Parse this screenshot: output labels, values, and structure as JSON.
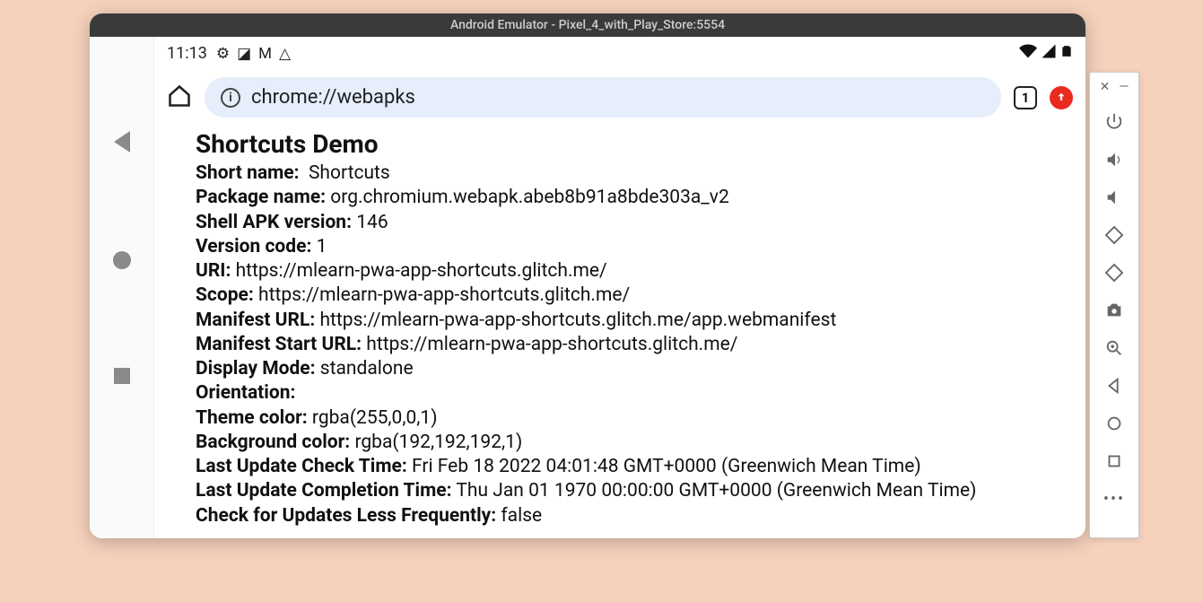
{
  "window": {
    "title": "Android Emulator - Pixel_4_with_Play_Store:5554"
  },
  "statusbar": {
    "time": "11:13"
  },
  "urlbar": {
    "url": "chrome://webapks",
    "tab_count": "1"
  },
  "page": {
    "title": "Shortcuts Demo",
    "fields": {
      "short_name": {
        "label": "Short name:",
        "value": "Shortcuts"
      },
      "package_name": {
        "label": "Package name:",
        "value": "org.chromium.webapk.abeb8b91a8bde303a_v2"
      },
      "shell_apk_version": {
        "label": "Shell APK version:",
        "value": "146"
      },
      "version_code": {
        "label": "Version code:",
        "value": "1"
      },
      "uri": {
        "label": "URI:",
        "value": "https://mlearn-pwa-app-shortcuts.glitch.me/"
      },
      "scope": {
        "label": "Scope:",
        "value": "https://mlearn-pwa-app-shortcuts.glitch.me/"
      },
      "manifest_url": {
        "label": "Manifest URL:",
        "value": "https://mlearn-pwa-app-shortcuts.glitch.me/app.webmanifest"
      },
      "manifest_start_url": {
        "label": "Manifest Start URL:",
        "value": "https://mlearn-pwa-app-shortcuts.glitch.me/"
      },
      "display_mode": {
        "label": "Display Mode:",
        "value": "standalone"
      },
      "orientation": {
        "label": "Orientation:",
        "value": ""
      },
      "theme_color": {
        "label": "Theme color:",
        "value": "rgba(255,0,0,1)"
      },
      "background_color": {
        "label": "Background color:",
        "value": "rgba(192,192,192,1)"
      },
      "last_update_check": {
        "label": "Last Update Check Time:",
        "value": "Fri Feb 18 2022 04:01:48 GMT+0000 (Greenwich Mean Time)"
      },
      "last_update_completion": {
        "label": "Last Update Completion Time:",
        "value": "Thu Jan 01 1970 00:00:00 GMT+0000 (Greenwich Mean Time)"
      },
      "check_updates_less": {
        "label": "Check for Updates Less Frequently:",
        "value": "false"
      }
    }
  }
}
